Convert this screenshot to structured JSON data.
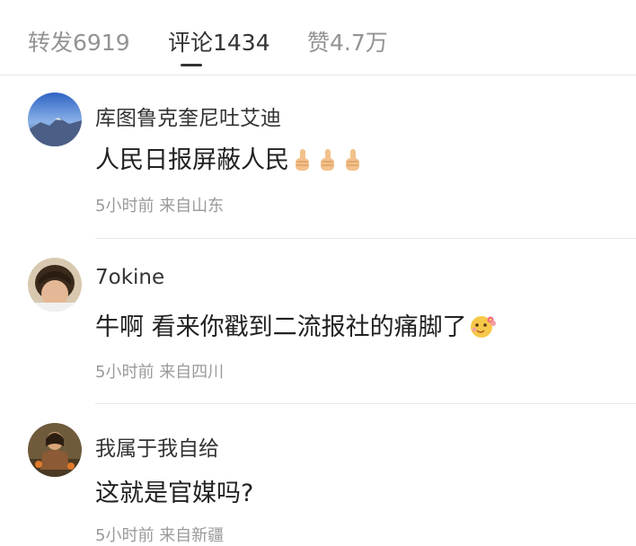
{
  "tabs": [
    {
      "label": "转发6919"
    },
    {
      "label": "评论1434",
      "active": true
    },
    {
      "label": "赞4.7万"
    }
  ],
  "comments": [
    {
      "username": "库图鲁克奎尼吐艾迪",
      "text": "人民日报屏蔽人民",
      "emojis": [
        "thumbs-up-icon",
        "thumbs-up-icon",
        "thumbs-up-icon"
      ],
      "time": "5小时前",
      "location": "来自山东"
    },
    {
      "username": "7okine",
      "text": "牛啊 看来你戳到二流报社的痛脚了",
      "emojis": [
        "flower-face-icon"
      ],
      "time": "5小时前",
      "location": "来自四川"
    },
    {
      "username": "我属于我自给",
      "text": "这就是官媒吗?",
      "emojis": [],
      "time": "5小时前",
      "location": "来自新疆"
    }
  ]
}
